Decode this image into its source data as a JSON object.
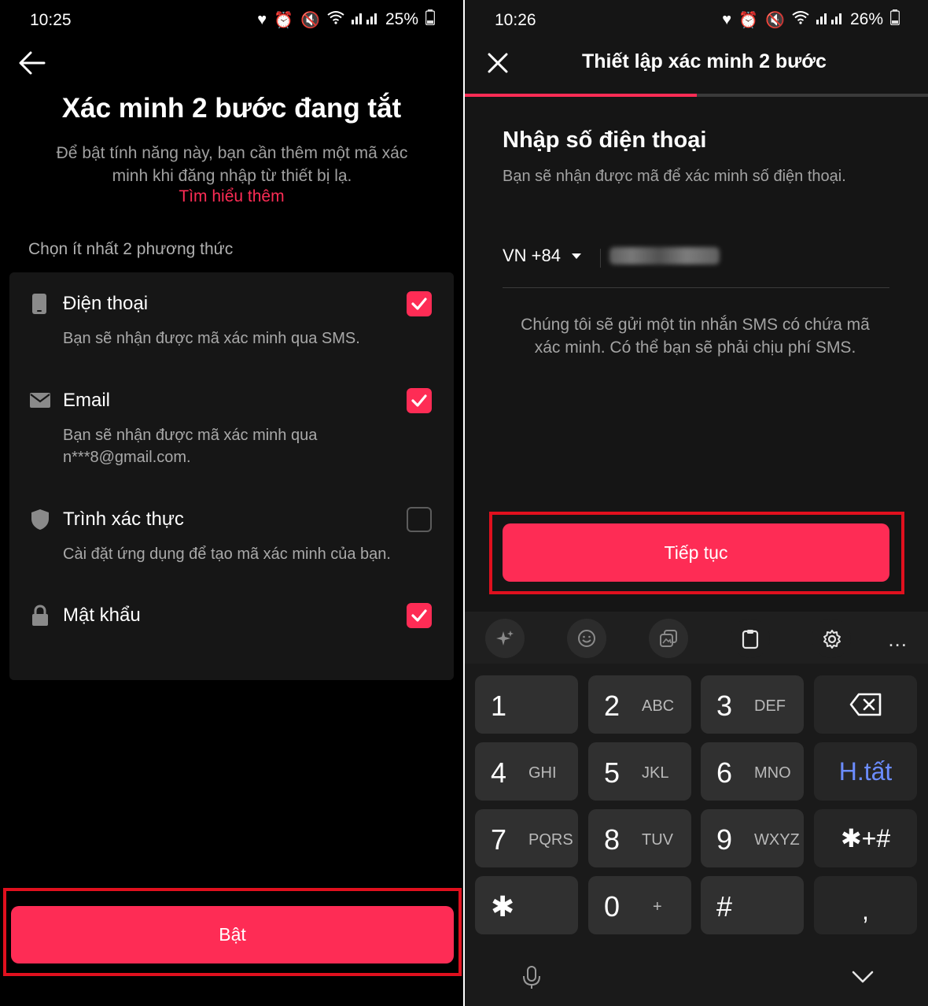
{
  "left": {
    "status": {
      "time": "10:25",
      "battery": "25%"
    },
    "title": "Xác minh 2 bước đang tắt",
    "description": "Để bật tính năng này, bạn cần thêm một mã xác minh khi đăng nhập từ thiết bị lạ.",
    "learn_more": "Tìm hiểu thêm",
    "choose_label": "Chọn ít nhất 2 phương thức",
    "methods": [
      {
        "title": "Điện thoại",
        "desc": "Bạn sẽ nhận được mã xác minh qua SMS.",
        "checked": true,
        "icon": "phone-icon"
      },
      {
        "title": "Email",
        "desc": "Bạn sẽ nhận được mã xác minh qua n***8@gmail.com.",
        "checked": true,
        "icon": "mail-icon"
      },
      {
        "title": "Trình xác thực",
        "desc": "Cài đặt ứng dụng để tạo mã xác minh của bạn.",
        "checked": false,
        "icon": "shield-icon"
      },
      {
        "title": "Mật khẩu",
        "desc": "",
        "checked": true,
        "icon": "lock-icon"
      }
    ],
    "primary_button": "Bật"
  },
  "right": {
    "status": {
      "time": "10:26",
      "battery": "26%"
    },
    "title": "Thiết lập xác minh 2 bước",
    "progress": 0.5,
    "heading": "Nhập số điện thoại",
    "subheading": "Bạn sẽ nhận được mã để xác minh số điện thoại.",
    "country_code": "VN +84",
    "sms_note": "Chúng tôi sẽ gửi một tin nhắn SMS có chứa mã xác minh. Có thể bạn sẽ phải chịu phí SMS.",
    "primary_button": "Tiếp tục",
    "keyboard": {
      "keys": [
        {
          "num": "1",
          "letters": ""
        },
        {
          "num": "2",
          "letters": "ABC"
        },
        {
          "num": "3",
          "letters": "DEF"
        },
        {
          "num": "4",
          "letters": "GHI"
        },
        {
          "num": "5",
          "letters": "JKL"
        },
        {
          "num": "6",
          "letters": "MNO"
        },
        {
          "num": "7",
          "letters": "PQRS"
        },
        {
          "num": "8",
          "letters": "TUV"
        },
        {
          "num": "9",
          "letters": "WXYZ"
        },
        {
          "num": "✱",
          "letters": ""
        },
        {
          "num": "0",
          "letters": "+"
        },
        {
          "num": "#",
          "letters": ""
        }
      ],
      "done_key": "H.tất",
      "symbols_key": "✱+#",
      "comma_key": ",",
      "more": "..."
    }
  },
  "colors": {
    "accent": "#fe2c55",
    "highlight_frame": "#e0101e",
    "link_blue": "#6b8cff"
  }
}
